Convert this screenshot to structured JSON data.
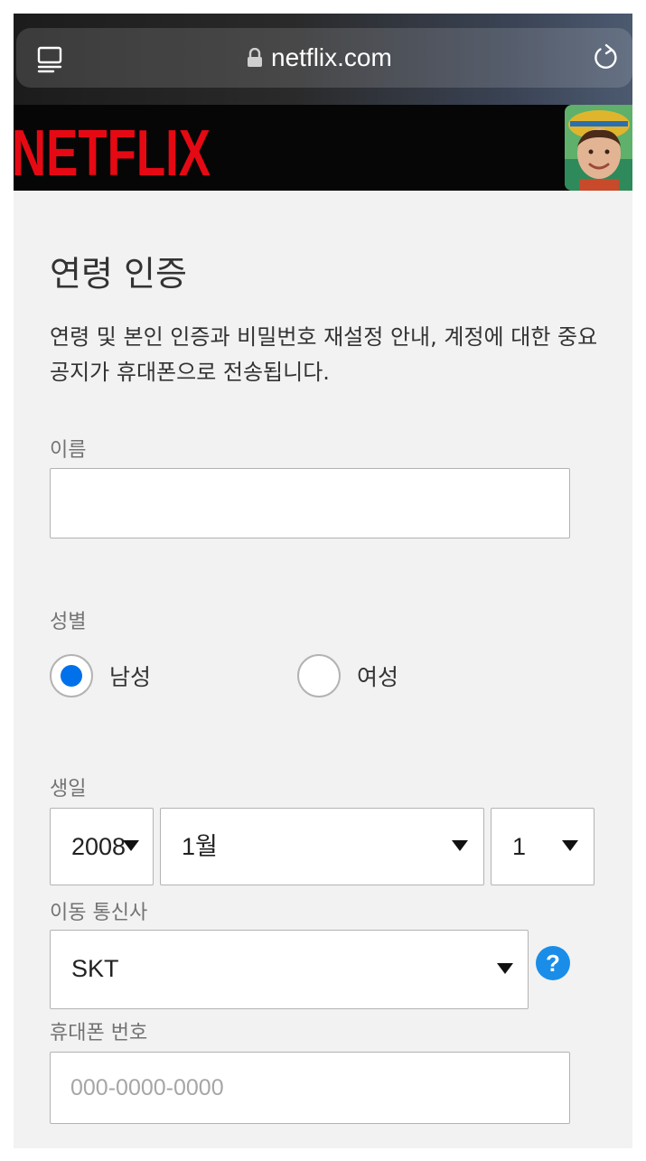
{
  "browser": {
    "url": "netflix.com",
    "tabs_icon": "tabs-icon",
    "lock_icon": "lock-icon",
    "reload_icon": "reload-icon"
  },
  "header": {
    "logo_text": "NETFLIX",
    "brand_color": "#e50914",
    "avatar": "profile-avatar"
  },
  "form": {
    "title": "연령 인증",
    "description": "연령 및 본인 인증과 비밀번호 재설정 안내, 계정에 대한 중요 공지가 휴대폰으로 전송됩니다.",
    "name": {
      "label": "이름",
      "value": ""
    },
    "gender": {
      "label": "성별",
      "options": [
        {
          "label": "남성",
          "selected": true
        },
        {
          "label": "여성",
          "selected": false
        }
      ],
      "accent_color": "#0071eb"
    },
    "birthday": {
      "label": "생일",
      "year": "2008",
      "month": "1월",
      "day": "1"
    },
    "carrier": {
      "label": "이동 통신사",
      "value": "SKT",
      "help_icon": "question-icon",
      "help_glyph": "?"
    },
    "phone": {
      "label": "휴대폰 번호",
      "placeholder": "000-0000-0000"
    }
  }
}
